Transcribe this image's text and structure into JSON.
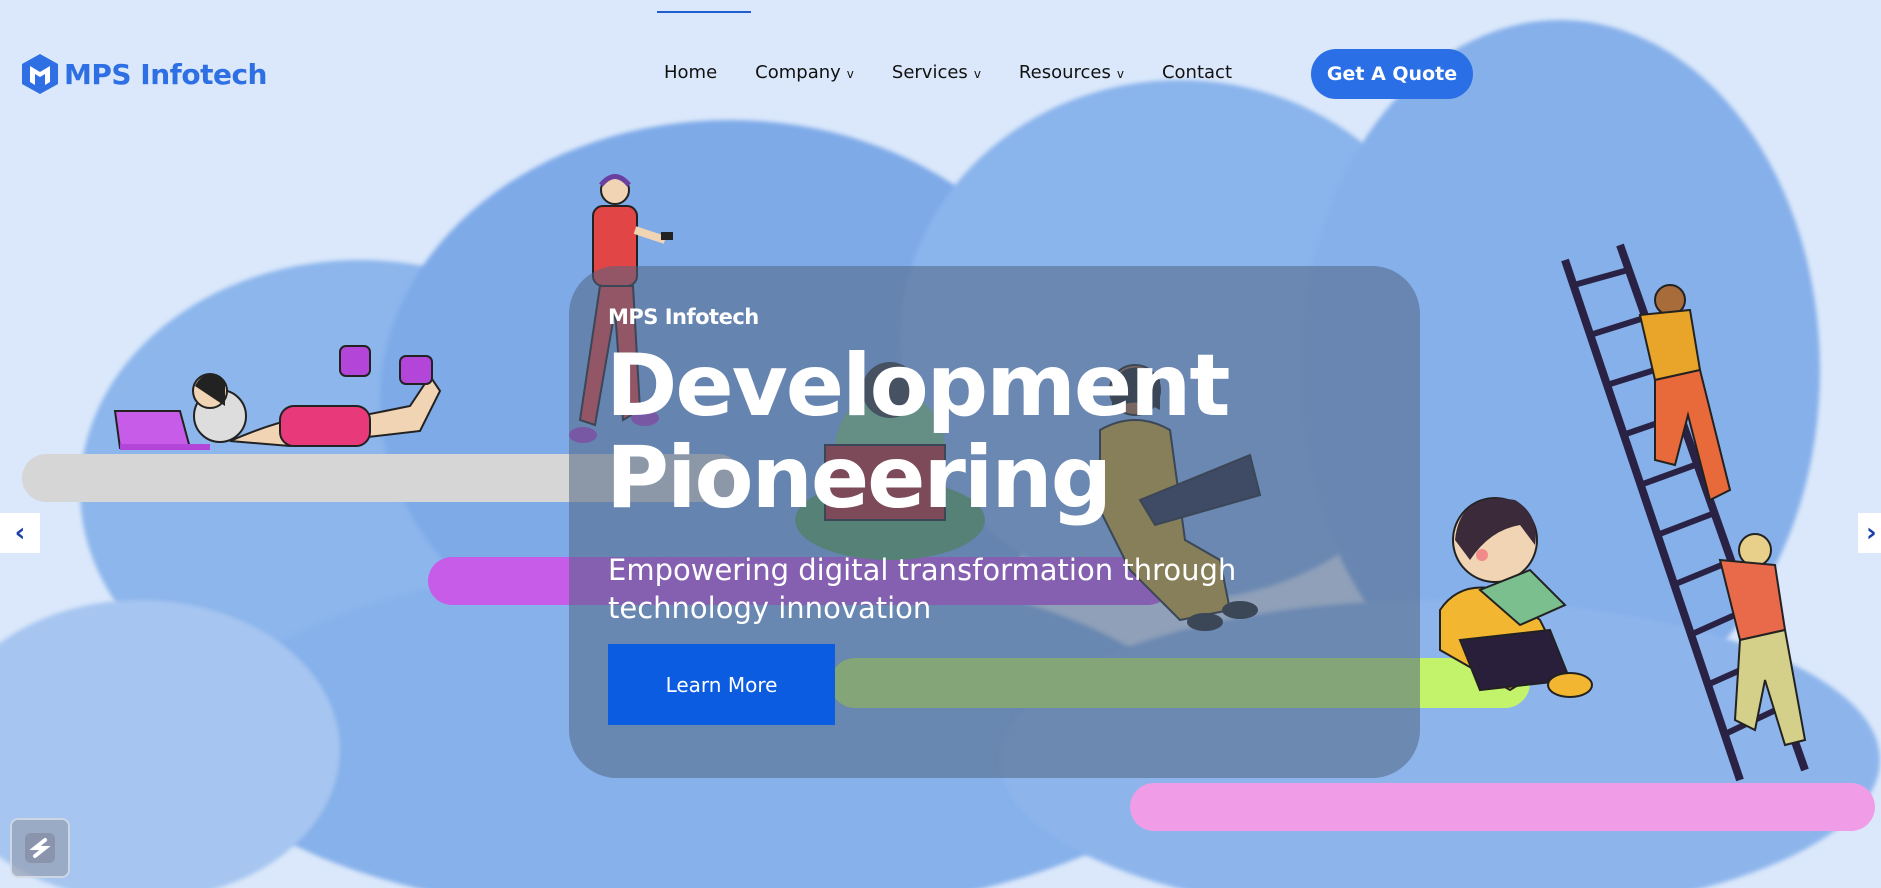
{
  "header": {
    "logo_text": "MPS Infotech",
    "logo_icon": "cube-icon",
    "nav": [
      {
        "label": "Home",
        "has_dropdown": false
      },
      {
        "label": "Company",
        "has_dropdown": true
      },
      {
        "label": "Services",
        "has_dropdown": true
      },
      {
        "label": "Resources",
        "has_dropdown": true
      },
      {
        "label": "Contact",
        "has_dropdown": false
      }
    ],
    "dropdown_glyph": "v",
    "cta_label": "Get A Quote"
  },
  "hero": {
    "kicker": "MPS Infotech",
    "title_line1": "Development",
    "title_line2": "Pioneering",
    "subtitle": "Empowering digital transformation through technology innovation",
    "button_label": "Learn More"
  },
  "slider": {
    "prev_icon": "chevron-left-icon",
    "next_icon": "chevron-right-icon",
    "prev_glyph": "‹",
    "next_glyph": "›"
  },
  "colors": {
    "accent": "#2a6fe6",
    "button": "#0b5ce0",
    "logo": "#2f6fe4",
    "bar_gray": "#d6d6d6",
    "bar_purple": "#c65ce8",
    "bar_green": "#8fbf52",
    "bar_pink": "#f09ce6"
  }
}
